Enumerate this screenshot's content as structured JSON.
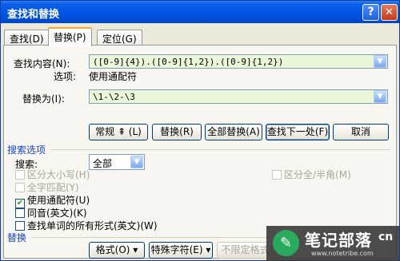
{
  "window": {
    "title": "查找和替换",
    "help_label": "?",
    "close_label": "✕"
  },
  "tabs": [
    {
      "label": "查找(D)"
    },
    {
      "label": "替换(P)"
    },
    {
      "label": "定位(G)"
    }
  ],
  "find": {
    "label": "查找内容(N):",
    "value": "([0-9]{4}).([0-9]{1,2}).([0-9]{1,2})",
    "options_label": "选项:",
    "options_value": "使用通配符"
  },
  "replace": {
    "label": "替换为(I):",
    "value": "\\1-\\2-\\3"
  },
  "buttons": {
    "less": "常规 ⇞ (L)",
    "replace": "替换(R)",
    "replace_all": "全部替换(A)",
    "find_next": "查找下一处(F)",
    "cancel": "取消"
  },
  "search_options": {
    "header": "搜索选项",
    "search_label": "搜索:",
    "search_value": "全部",
    "checkboxes": [
      {
        "label": "区分大小写(H)",
        "checked": false,
        "disabled": true
      },
      {
        "label": "全字匹配(Y)",
        "checked": false,
        "disabled": true
      },
      {
        "label": "使用通配符(U)",
        "checked": true,
        "disabled": false
      },
      {
        "label": "同音(英文)(K)",
        "checked": false,
        "disabled": false
      },
      {
        "label": "查找单词的所有形式(英文)(W)",
        "checked": false,
        "disabled": false
      }
    ],
    "right_checkbox": {
      "label": "区分全/半角(M)",
      "checked": false,
      "disabled": true
    }
  },
  "replace_section": {
    "header": "替换",
    "format_button": "格式(O) ▾",
    "special_button": "特殊字符(E) ▾",
    "no_format_button": "不限定格式(T)"
  },
  "watermark": {
    "title": "笔记部落",
    "url": "www.notetribe.com",
    "suffix": "cn"
  }
}
